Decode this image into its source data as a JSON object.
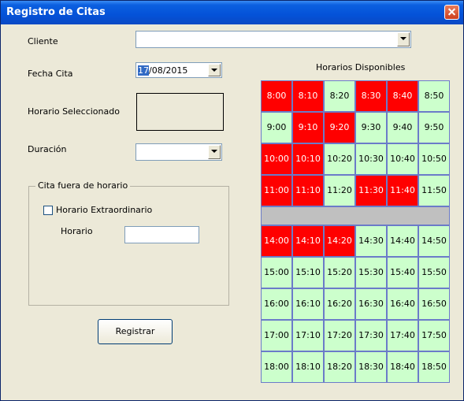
{
  "window": {
    "title": "Registro de Citas"
  },
  "form": {
    "cliente_label": "Cliente",
    "cliente_value": "",
    "fecha_label": "Fecha Cita",
    "fecha_day_selected": "17",
    "fecha_rest": "/08/2015",
    "horario_sel_label": "Horario Seleccionado",
    "duracion_label": "Duración",
    "duracion_value": "",
    "fuera": {
      "title": "Cita fuera de horario",
      "checkbox_label": "Horario Extraordinario",
      "checked": false,
      "horario_label": "Horario",
      "horario_value": ""
    },
    "registrar_label": "Registrar"
  },
  "horarios": {
    "title": "Horarios Disponibles",
    "colors": {
      "free": "#ccffcc",
      "busy": "#ff0000",
      "break": "#c0c0c0"
    },
    "morning": [
      [
        {
          "t": "8:00",
          "busy": true
        },
        {
          "t": "8:10",
          "busy": true
        },
        {
          "t": "8:20",
          "busy": false
        },
        {
          "t": "8:30",
          "busy": true
        },
        {
          "t": "8:40",
          "busy": true
        },
        {
          "t": "8:50",
          "busy": false
        }
      ],
      [
        {
          "t": "9:00",
          "busy": false
        },
        {
          "t": "9:10",
          "busy": true
        },
        {
          "t": "9:20",
          "busy": true
        },
        {
          "t": "9:30",
          "busy": false
        },
        {
          "t": "9:40",
          "busy": false
        },
        {
          "t": "9:50",
          "busy": false
        }
      ],
      [
        {
          "t": "10:00",
          "busy": true
        },
        {
          "t": "10:10",
          "busy": true
        },
        {
          "t": "10:20",
          "busy": false
        },
        {
          "t": "10:30",
          "busy": false
        },
        {
          "t": "10:40",
          "busy": false
        },
        {
          "t": "10:50",
          "busy": false
        }
      ],
      [
        {
          "t": "11:00",
          "busy": true
        },
        {
          "t": "11:10",
          "busy": true
        },
        {
          "t": "11:20",
          "busy": false
        },
        {
          "t": "11:30",
          "busy": true
        },
        {
          "t": "11:40",
          "busy": true
        },
        {
          "t": "11:50",
          "busy": false
        }
      ]
    ],
    "afternoon": [
      [
        {
          "t": "14:00",
          "busy": true
        },
        {
          "t": "14:10",
          "busy": true
        },
        {
          "t": "14:20",
          "busy": true
        },
        {
          "t": "14:30",
          "busy": false
        },
        {
          "t": "14:40",
          "busy": false
        },
        {
          "t": "14:50",
          "busy": false
        }
      ],
      [
        {
          "t": "15:00",
          "busy": false
        },
        {
          "t": "15:10",
          "busy": false
        },
        {
          "t": "15:20",
          "busy": false
        },
        {
          "t": "15:30",
          "busy": false
        },
        {
          "t": "15:40",
          "busy": false
        },
        {
          "t": "15:50",
          "busy": false
        }
      ],
      [
        {
          "t": "16:00",
          "busy": false
        },
        {
          "t": "16:10",
          "busy": false
        },
        {
          "t": "16:20",
          "busy": false
        },
        {
          "t": "16:30",
          "busy": false
        },
        {
          "t": "16:40",
          "busy": false
        },
        {
          "t": "16:50",
          "busy": false
        }
      ],
      [
        {
          "t": "17:00",
          "busy": false
        },
        {
          "t": "17:10",
          "busy": false
        },
        {
          "t": "17:20",
          "busy": false
        },
        {
          "t": "17:30",
          "busy": false
        },
        {
          "t": "17:40",
          "busy": false
        },
        {
          "t": "17:50",
          "busy": false
        }
      ],
      [
        {
          "t": "18:00",
          "busy": false
        },
        {
          "t": "18:10",
          "busy": false
        },
        {
          "t": "18:20",
          "busy": false
        },
        {
          "t": "18:30",
          "busy": false
        },
        {
          "t": "18:40",
          "busy": false
        },
        {
          "t": "18:50",
          "busy": false
        }
      ]
    ]
  }
}
